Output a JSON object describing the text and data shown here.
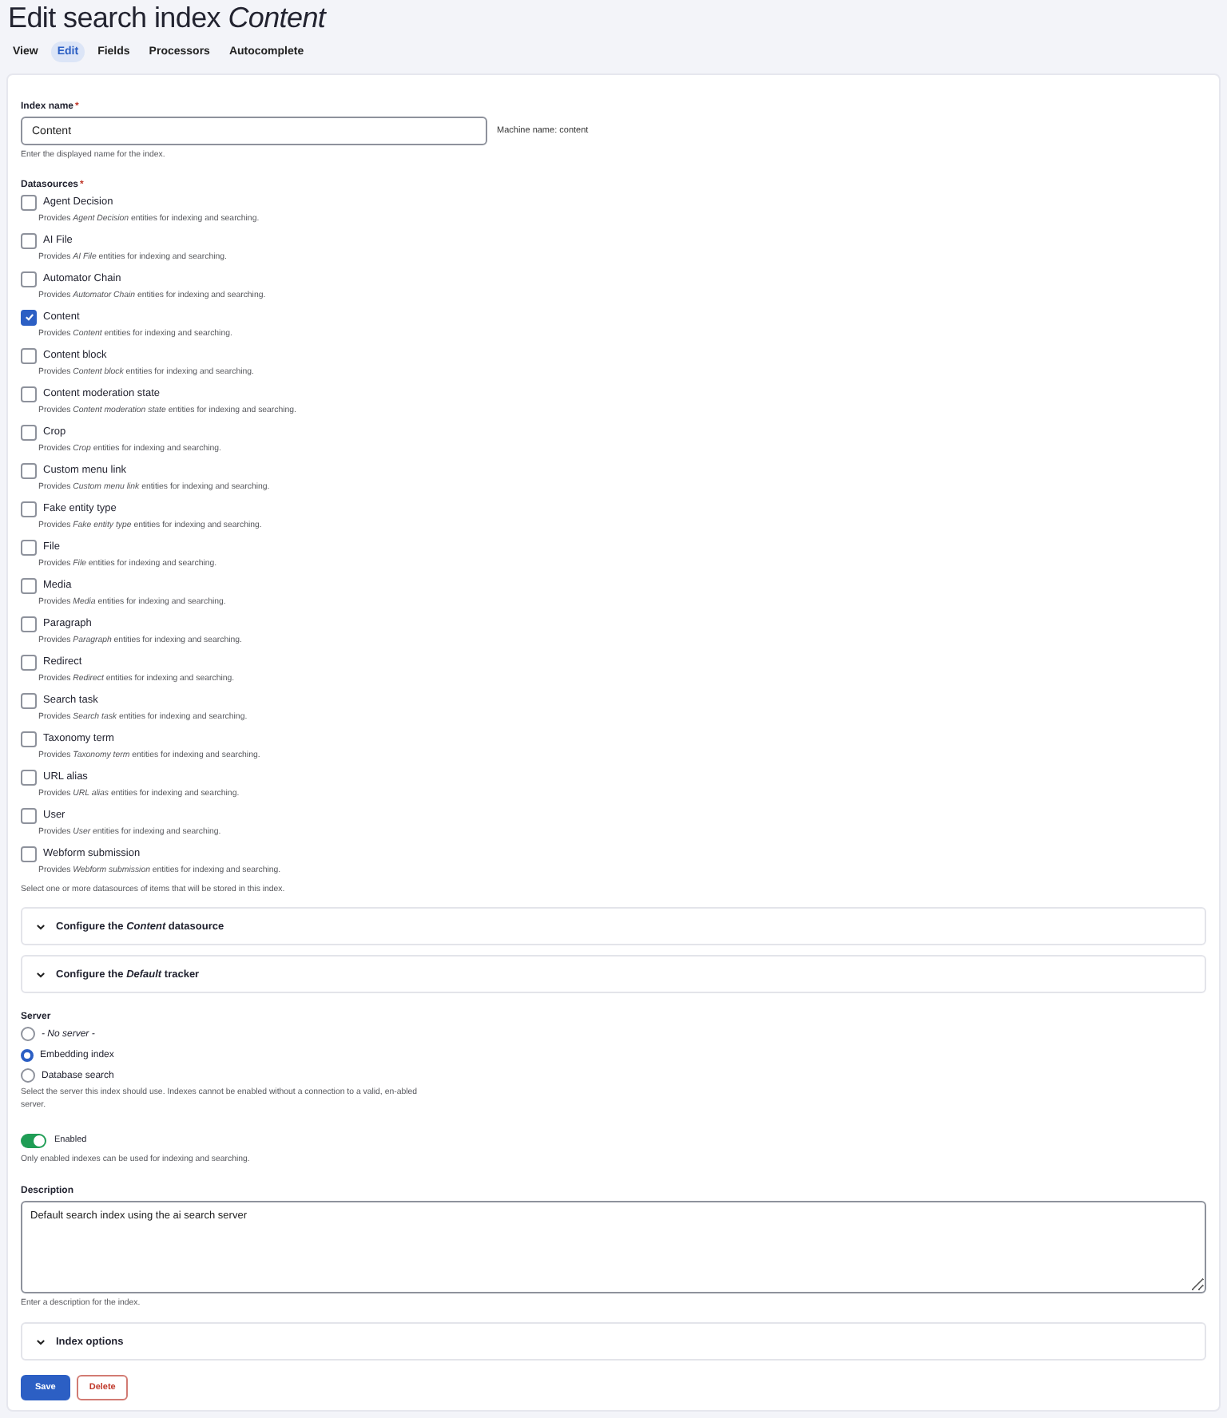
{
  "page_title": "Edit search index *Content*",
  "tabs": [
    {
      "label": "View",
      "selected": false
    },
    {
      "label": "Edit",
      "selected": true
    },
    {
      "label": "Fields",
      "selected": false
    },
    {
      "label": "Processors",
      "selected": false
    },
    {
      "label": "Autocomplete",
      "selected": false
    }
  ],
  "index_name": {
    "label": "Index name",
    "required_mark": "*",
    "value": "Content",
    "machine_name": "Machine name: content",
    "help": "Enter the displayed name for the index."
  },
  "datasources": {
    "label": "Datasources",
    "required_mark": "*",
    "items": [
      {
        "label": "Agent Decision",
        "description": "Provides *Agent Decision* entities for indexing and searching.",
        "checked": false
      },
      {
        "label": "AI File",
        "description": "Provides *AI File* entities for indexing and searching.",
        "checked": false
      },
      {
        "label": "Automator Chain",
        "description": "Provides *Automator Chain* entities for indexing and searching.",
        "checked": false
      },
      {
        "label": "Content",
        "description": "Provides *Content* entities for indexing and searching.",
        "checked": true
      },
      {
        "label": "Content block",
        "description": "Provides *Content block* entities for indexing and searching.",
        "checked": false
      },
      {
        "label": "Content moderation state",
        "description": "Provides *Content moderation state* entities for indexing and searching.",
        "checked": false
      },
      {
        "label": "Crop",
        "description": "Provides *Crop* entities for indexing and searching.",
        "checked": false
      },
      {
        "label": "Custom menu link",
        "description": "Provides *Custom menu link* entities for indexing and searching.",
        "checked": false
      },
      {
        "label": "Fake entity type",
        "description": "Provides *Fake entity type* entities for indexing and searching.",
        "checked": false
      },
      {
        "label": "File",
        "description": "Provides *File* entities for indexing and searching.",
        "checked": false
      },
      {
        "label": "Media",
        "description": "Provides *Media* entities for indexing and searching.",
        "checked": false
      },
      {
        "label": "Paragraph",
        "description": "Provides *Paragraph* entities for indexing and searching.",
        "checked": false
      },
      {
        "label": "Redirect",
        "description": "Provides *Redirect* entities for indexing and searching.",
        "checked": false
      },
      {
        "label": "Search task",
        "description": "Provides *Search task* entities for indexing and searching.",
        "checked": false
      },
      {
        "label": "Taxonomy term",
        "description": "Provides *Taxonomy term* entities for indexing and searching.",
        "checked": false
      },
      {
        "label": "URL alias",
        "description": "Provides *URL alias* entities for indexing and searching.",
        "checked": false
      },
      {
        "label": "User",
        "description": "Provides *User* entities for indexing and searching.",
        "checked": false
      },
      {
        "label": "Webform submission",
        "description": "Provides *Webform submission* entities for indexing and searching.",
        "checked": false
      }
    ],
    "help": "Select one or more datasources of items that will be stored in this index."
  },
  "config_sections": [
    {
      "title": "Configure the *Content* datasource",
      "expanded": false
    },
    {
      "title": "Configure the *Default* tracker",
      "expanded": false
    }
  ],
  "server": {
    "label": "Server",
    "options": [
      {
        "label": "- No server -",
        "italic": true,
        "selected": false
      },
      {
        "label": "Embedding index",
        "italic": false,
        "selected": true
      },
      {
        "label": "Database search",
        "italic": false,
        "selected": false
      }
    ],
    "help": "Select the server this index should use. Indexes cannot be enabled without a connection to a valid, en-abled server."
  },
  "enabled": {
    "label": "Enabled",
    "on": true,
    "help": "Only enabled indexes can be used for indexing and searching."
  },
  "description": {
    "label": "Description",
    "value": "Default search index using the ai search server",
    "help": "Enter a description for the index."
  },
  "index_options": {
    "title": "Index options",
    "expanded": false
  },
  "buttons": [
    {
      "label": "Save",
      "kind": "primary"
    },
    {
      "label": "Delete",
      "kind": "danger"
    }
  ]
}
